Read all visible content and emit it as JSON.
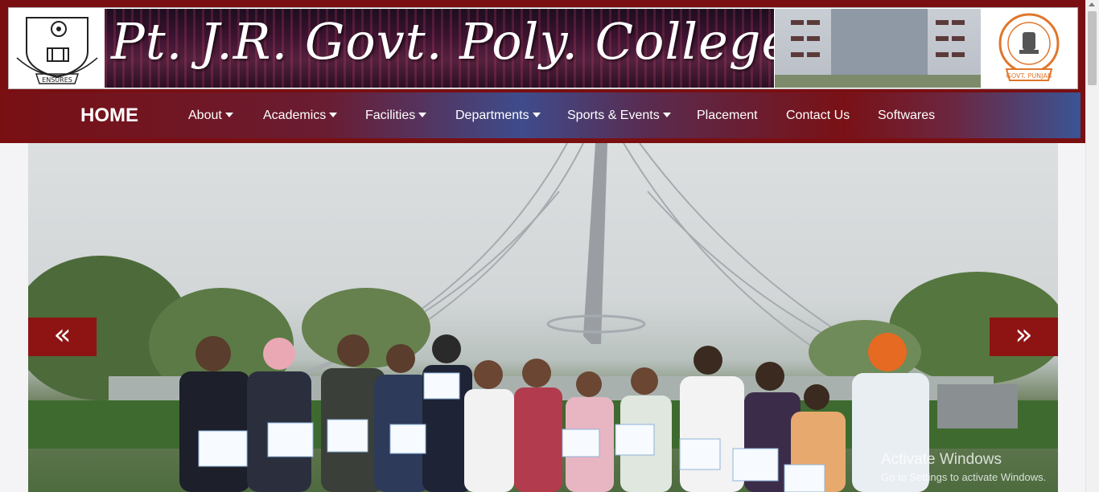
{
  "header": {
    "title": "Pt. J.R. Govt. Poly. College",
    "left_logo_label": "ENSURES",
    "right_logo_label": "GOVT. PUNJAB"
  },
  "nav": {
    "home": "HOME",
    "items": [
      {
        "label": "About",
        "dropdown": true
      },
      {
        "label": "Academics",
        "dropdown": true
      },
      {
        "label": "Facilities",
        "dropdown": true
      },
      {
        "label": "Departments",
        "dropdown": true
      },
      {
        "label": "Sports & Events",
        "dropdown": true
      },
      {
        "label": "Placement",
        "dropdown": false
      },
      {
        "label": "Contact Us",
        "dropdown": false
      },
      {
        "label": "Softwares",
        "dropdown": false
      }
    ]
  },
  "slider": {
    "prev_icon": "«",
    "next_icon": "»"
  },
  "watermark": {
    "title": "Activate Windows",
    "subtitle": "Go to Settings to activate Windows."
  },
  "colors": {
    "header_bg": "#7a0f12",
    "nav_blue": "#3e4c8c",
    "control_bg": "#8e1414"
  }
}
